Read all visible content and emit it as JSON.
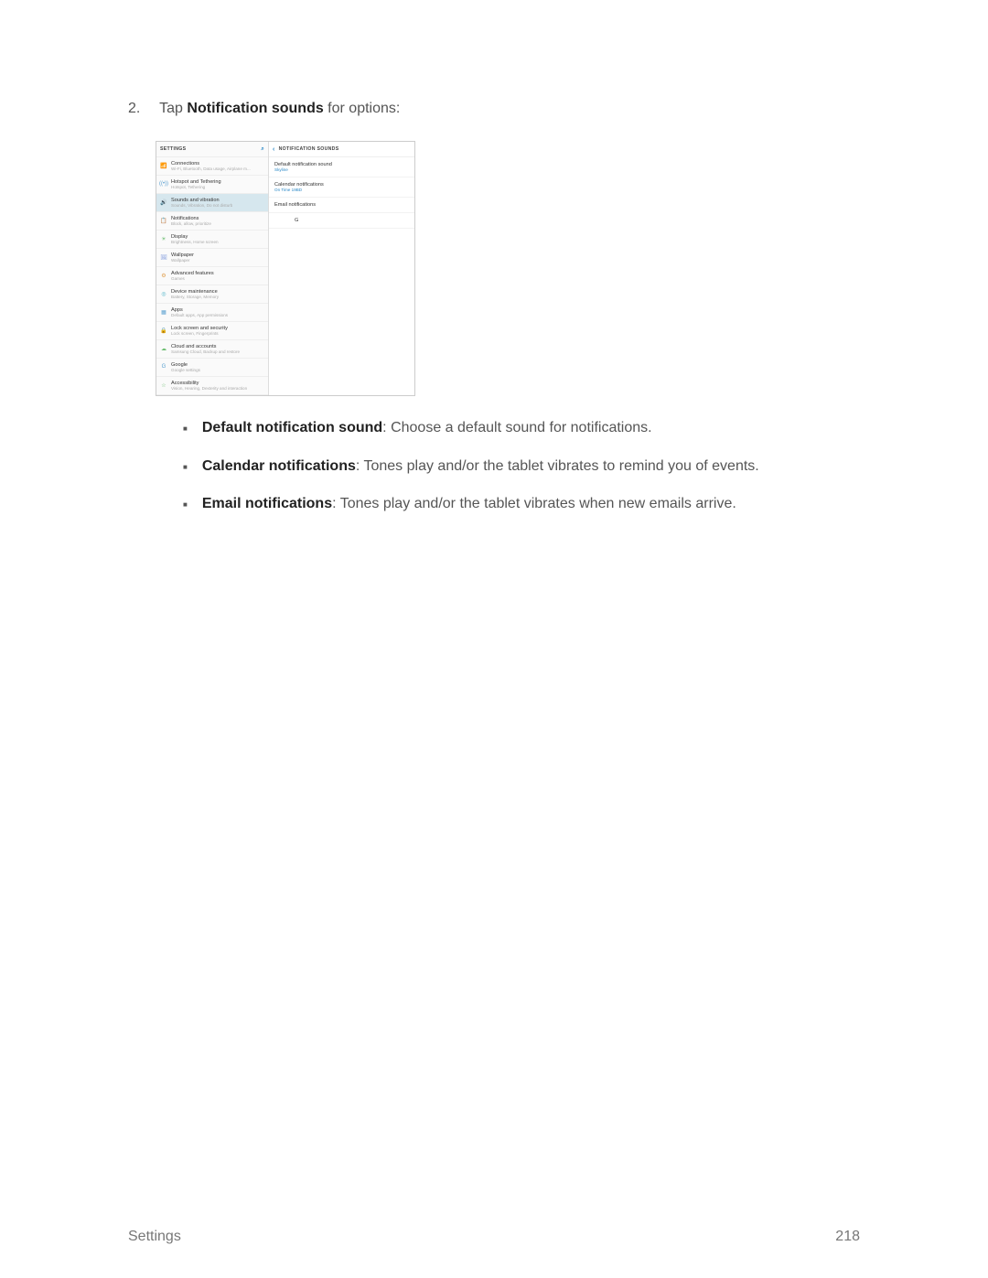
{
  "step": {
    "number": "2.",
    "prefix": "Tap ",
    "bold1": "Notification ",
    "bold2": "sounds",
    "suffix": " for options:"
  },
  "screenshot": {
    "settings_header": "SETTINGS",
    "detail_header": "NOTIFICATION SOUNDS",
    "settings_items": [
      {
        "title": "Connections",
        "sub": "Wi-Fi, Bluetooth, Data usage, Airplane m...",
        "icon": "📶",
        "color": "#5aa0d0"
      },
      {
        "title": "Hotspot and Tethering",
        "sub": "Hotspot, Tethering",
        "icon": "((•))",
        "color": "#5aa0d0"
      },
      {
        "title": "Sounds and vibration",
        "sub": "Sounds, Vibration, Do not disturb",
        "icon": "🔊",
        "color": "#4db3c7",
        "selected": true
      },
      {
        "title": "Notifications",
        "sub": "Block, allow, prioritize",
        "icon": "📋",
        "color": "#e78f8f"
      },
      {
        "title": "Display",
        "sub": "Brightness, Home screen",
        "icon": "☀",
        "color": "#6fbf73"
      },
      {
        "title": "Wallpaper",
        "sub": "Wallpaper",
        "icon": "🖼",
        "color": "#8fa6e0"
      },
      {
        "title": "Advanced features",
        "sub": "Games",
        "icon": "⚙",
        "color": "#e0a050"
      },
      {
        "title": "Device maintenance",
        "sub": "Battery, Storage, Memory",
        "icon": "◎",
        "color": "#4db3c7"
      },
      {
        "title": "Apps",
        "sub": "Default apps, App permissions",
        "icon": "▦",
        "color": "#5aa0d0"
      },
      {
        "title": "Lock screen and security",
        "sub": "Lock screen, Fingerprints",
        "icon": "🔒",
        "color": "#e0a050"
      },
      {
        "title": "Cloud and accounts",
        "sub": "Samsung Cloud, Backup and restore",
        "icon": "☁",
        "color": "#6fbf73"
      },
      {
        "title": "Google",
        "sub": "Google settings",
        "icon": "G",
        "color": "#5aa0d0"
      },
      {
        "title": "Accessibility",
        "sub": "Vision, Hearing, Dexterity and interaction",
        "icon": "☆",
        "color": "#6fbf73"
      }
    ],
    "detail_items": [
      {
        "title": "Default notification sound",
        "sub": "Skyline"
      },
      {
        "title": "Calendar notifications",
        "sub": "On Time     19BD"
      },
      {
        "title": "Email notifications",
        "sub": ""
      },
      {
        "title": "G",
        "sub": "",
        "indent": true
      }
    ]
  },
  "bullets": [
    {
      "bold": "Default notification sound",
      "text": ": Choose a default sound for notifications."
    },
    {
      "bold": "Calendar notifications",
      "text": ": Tones play and/or the tablet vibrates to remind you of events."
    },
    {
      "bold": "Email notifications",
      "text": ": Tones play and/or the tablet vibrates when new emails arrive."
    }
  ],
  "footer": {
    "left": "Settings",
    "right": "218"
  }
}
